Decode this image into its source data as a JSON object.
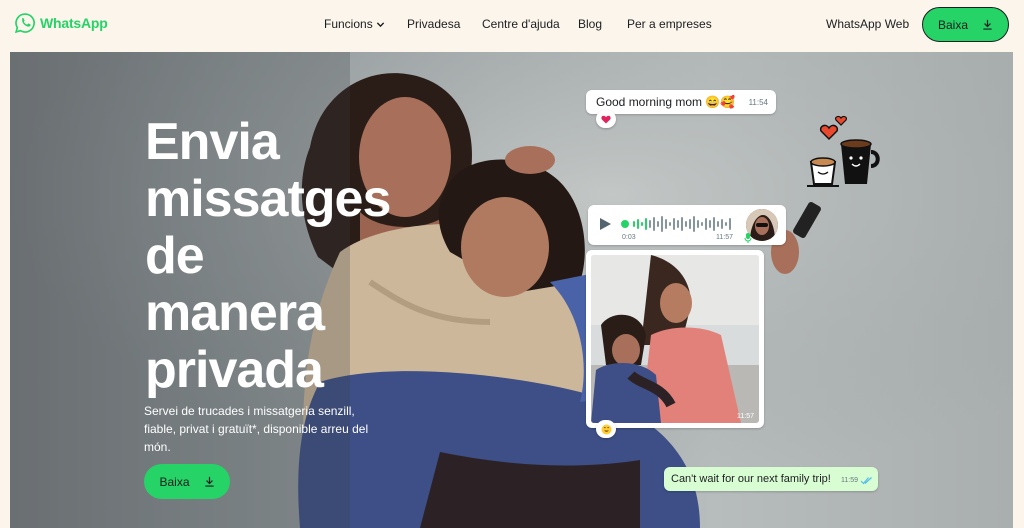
{
  "brand": {
    "name": "WhatsApp",
    "color": "#25d366",
    "icon": "whatsapp-logo-icon"
  },
  "nav": {
    "items": [
      {
        "label": "Funcions",
        "has_dropdown": true
      },
      {
        "label": "Privadesa"
      },
      {
        "label": "Centre d'ajuda"
      },
      {
        "label": "Blog"
      },
      {
        "label": "Per a empreses"
      }
    ],
    "web_label": "WhatsApp Web",
    "download_label": "Baixa"
  },
  "hero": {
    "title_lines": [
      "Envia",
      "missatges",
      "de",
      "manera",
      "privada"
    ],
    "subtitle": "Servei de trucades i missatgeria senzill, fiable, privat i gratuït*, disponible arreu del món.",
    "button_label": "Baixa"
  },
  "chat": {
    "message_1": {
      "text": "Good morning mom 😄🥰",
      "time": "11:54",
      "reaction": "heart-icon"
    },
    "voice_note": {
      "elapsed": "0:03",
      "time": "11:57"
    },
    "photo": {
      "time": "11:57",
      "reaction": "smile-emoji-icon"
    },
    "message_2": {
      "text": "Can't wait for our next family trip!",
      "time": "11:59"
    }
  },
  "colors": {
    "background": "#fcf5eb",
    "accent": "#25d366",
    "bubble_out": "#d9fdd3"
  }
}
